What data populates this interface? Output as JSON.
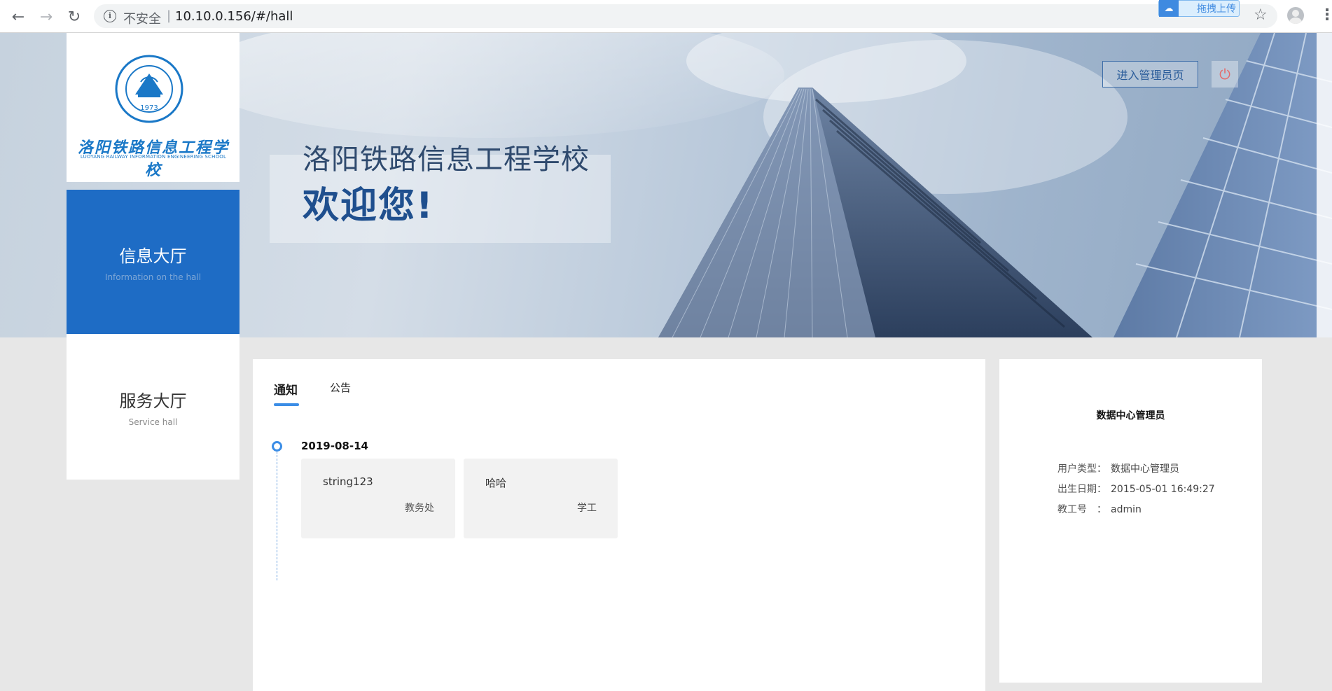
{
  "browser": {
    "insecure_label": "不安全",
    "separator": "|",
    "url": "10.10.0.156/#/hall",
    "upload_label": "拖拽上传"
  },
  "banner": {
    "admin_button": "进入管理员页",
    "school_title": "洛阳铁路信息工程学校",
    "welcome": "欢迎您!"
  },
  "logo": {
    "name_cn": "洛阳铁路信息工程学校",
    "name_en": "LUOYANG RAILWAY INFORMATION ENGINEERING SCHOOL",
    "seal_year": "1973"
  },
  "nav": {
    "items": [
      {
        "label": "信息大厅",
        "sublabel": "Information on the hall",
        "active": true
      },
      {
        "label": "服务大厅",
        "sublabel": "Service hall",
        "active": false
      }
    ]
  },
  "notices": {
    "tabs": [
      {
        "label": "通知",
        "active": true
      },
      {
        "label": "公告",
        "active": false
      }
    ],
    "date": "2019-08-14",
    "items": [
      {
        "title": "string123",
        "dept": "教务处"
      },
      {
        "title": "哈哈",
        "dept": "学工"
      }
    ]
  },
  "profile": {
    "title": "数据中心管理员",
    "rows": [
      {
        "key": "用户类型：",
        "value": "数据中心管理员"
      },
      {
        "key": "出生日期：",
        "value": "2015-05-01 16:49:27"
      },
      {
        "key": "教工号　：",
        "value": "admin"
      }
    ]
  },
  "colors": {
    "primary": "#1e6cc5",
    "accent": "#3b8de6",
    "page_bg": "#e7e7e7"
  }
}
